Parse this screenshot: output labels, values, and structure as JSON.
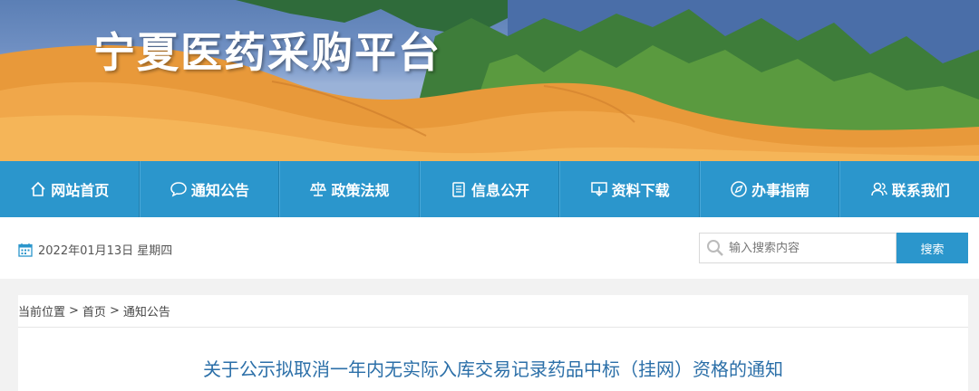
{
  "header": {
    "site_title": "宁夏医药采购平台"
  },
  "nav": {
    "items": [
      {
        "label": "网站首页",
        "icon": "home-icon"
      },
      {
        "label": "通知公告",
        "icon": "chat-bubble-icon"
      },
      {
        "label": "政策法规",
        "icon": "scale-icon"
      },
      {
        "label": "信息公开",
        "icon": "document-icon"
      },
      {
        "label": "资料下载",
        "icon": "download-icon"
      },
      {
        "label": "办事指南",
        "icon": "compass-icon"
      },
      {
        "label": "联系我们",
        "icon": "users-icon"
      }
    ]
  },
  "infobar": {
    "date": "2022年01月13日 星期四",
    "search_placeholder": "输入搜索内容",
    "search_button": "搜索"
  },
  "breadcrumb": {
    "prefix": "当前位置",
    "sep": ">",
    "home": "首页",
    "current": "通知公告"
  },
  "article": {
    "title": "关于公示拟取消一年内无实际入库交易记录药品中标（挂网）资格的通知"
  },
  "colors": {
    "nav_bg": "#2b96cc",
    "title_blue": "#2b6fa8",
    "sand": "#e89a3c"
  }
}
